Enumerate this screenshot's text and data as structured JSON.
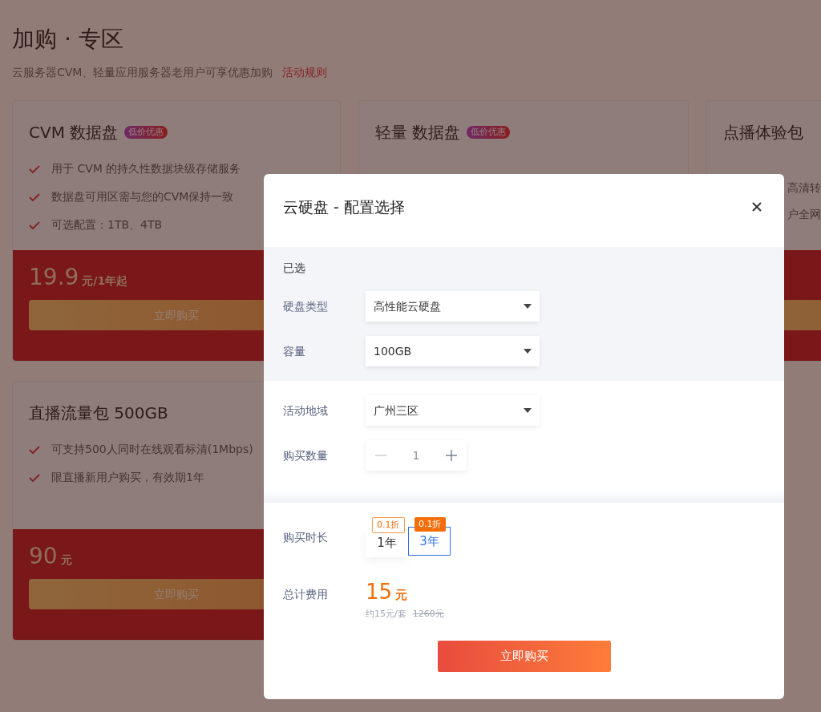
{
  "page": {
    "title": "加购 · 专区",
    "subtitle": "云服务器CVM、轻量应用服务器老用户可享优惠加购",
    "rules_link": "活动规则"
  },
  "cards": [
    {
      "title": "CVM 数据盘",
      "badge": "低价优惠",
      "features": [
        "用于 CVM 的持久性数据块级存储服务",
        "数据盘可用区需与您的CVM保持一致",
        "可选配置：1TB、4TB"
      ],
      "price": "19.9",
      "unit": "元/1年起",
      "button": "立即购买"
    },
    {
      "title": "轻量 数据盘",
      "badge": "低价优惠"
    },
    {
      "title": "点播体验包",
      "price_panel": true,
      "features_clipped": true,
      "features": [
        "高清转",
        "户全网"
      ]
    },
    {
      "title": "直播流量包 500GB",
      "features": [
        "可支持500人同时在线观看标清(1Mbps)",
        "限直播新用户购买，有效期1年"
      ],
      "price": "90",
      "unit": "元",
      "button": "立即购买"
    }
  ],
  "modal": {
    "title": "云硬盘 - 配置选择",
    "selected_label": "已选",
    "selected_fields": [
      {
        "label": "硬盘类型",
        "value": "高性能云硬盘"
      },
      {
        "label": "容量",
        "value": "100GB"
      }
    ],
    "region": {
      "label": "活动地域",
      "value": "广州三区"
    },
    "quantity": {
      "label": "购买数量",
      "value": "1"
    },
    "duration": {
      "label": "购买时长",
      "options": [
        {
          "label": "1年",
          "tag": "0.1折",
          "selected": false
        },
        {
          "label": "3年",
          "tag": "0.1折",
          "selected": true
        }
      ]
    },
    "total": {
      "label": "总计费用",
      "amount": "15",
      "unit": "元",
      "per_unit": "约15元/套",
      "original": "1260元"
    },
    "buy_button": "立即购买"
  }
}
